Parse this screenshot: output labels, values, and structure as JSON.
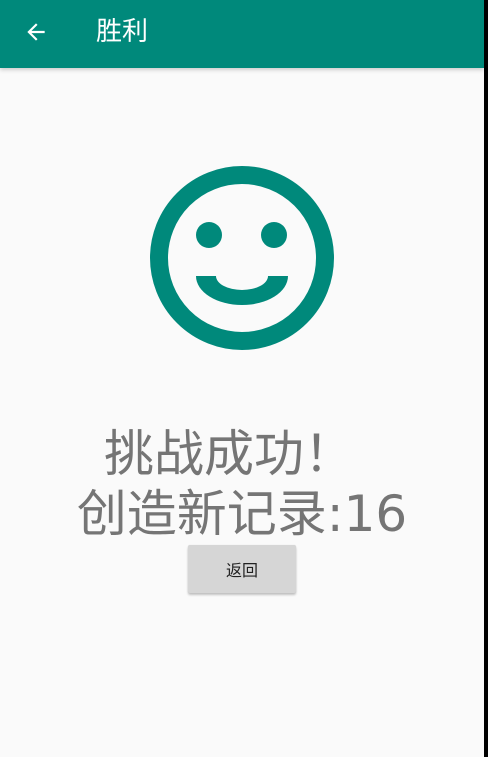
{
  "app_bar": {
    "title": "胜利",
    "back_icon": "arrow-back-icon",
    "background_color": "#00897b"
  },
  "main": {
    "smiley_icon": "smiley-face-icon",
    "icon_color": "#00897b",
    "message_line1": "挑战成功！",
    "message_line2": "创造新记录:16",
    "return_button_label": "返回"
  }
}
